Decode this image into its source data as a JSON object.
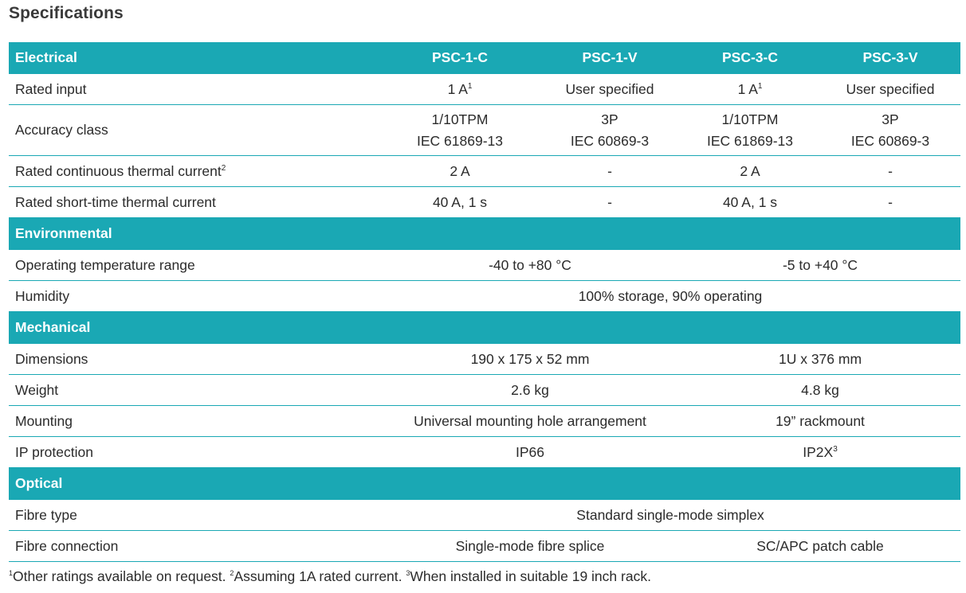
{
  "title": "Specifications",
  "columns": [
    "PSC-1-C",
    "PSC-1-V",
    "PSC-3-C",
    "PSC-3-V"
  ],
  "sections": {
    "electrical": {
      "heading": "Electrical",
      "rated_input": {
        "label": "Rated input",
        "c1": "1 A",
        "c1_sup": "1",
        "c2": "User specified",
        "c3": "1 A",
        "c3_sup": "1",
        "c4": "User specified"
      },
      "accuracy_class": {
        "label": "Accuracy class",
        "c1_l1": "1/10TPM",
        "c1_l2": "IEC 61869-13",
        "c2_l1": "3P",
        "c2_l2": "IEC 60869-3",
        "c3_l1": "1/10TPM",
        "c3_l2": "IEC 61869-13",
        "c4_l1": "3P",
        "c4_l2": "IEC 60869-3"
      },
      "continuous_current": {
        "label": "Rated continuous thermal current",
        "label_sup": "2",
        "c1": "2 A",
        "c2": "-",
        "c3": "2 A",
        "c4": "-"
      },
      "short_time_current": {
        "label": "Rated short-time thermal current",
        "c1": "40 A, 1 s",
        "c2": "-",
        "c3": "40 A, 1 s",
        "c4": "-"
      }
    },
    "environmental": {
      "heading": "Environmental",
      "temperature": {
        "label": "Operating temperature range",
        "psc1": "-40 to +80 °C",
        "psc3": "-5 to +40 °C"
      },
      "humidity": {
        "label": "Humidity",
        "all": "100% storage, 90% operating"
      }
    },
    "mechanical": {
      "heading": "Mechanical",
      "dimensions": {
        "label": "Dimensions",
        "psc1": "190 x 175 x 52 mm",
        "psc3": "1U x 376 mm"
      },
      "weight": {
        "label": "Weight",
        "psc1": "2.6 kg",
        "psc3": "4.8 kg"
      },
      "mounting": {
        "label": "Mounting",
        "psc1": "Universal mounting hole arrangement",
        "psc3": "19” rackmount"
      },
      "ip_protection": {
        "label": "IP protection",
        "psc1": "IP66",
        "psc3": "IP2X",
        "psc3_sup": "3"
      }
    },
    "optical": {
      "heading": "Optical",
      "fibre_type": {
        "label": "Fibre type",
        "all": "Standard single-mode simplex"
      },
      "fibre_connection": {
        "label": "Fibre connection",
        "psc1": "Single-mode fibre splice",
        "psc3": "SC/APC patch cable"
      }
    }
  },
  "footnotes": {
    "n1": "1",
    "t1": "Other ratings available on request.",
    "n2": "2",
    "t2": "Assuming 1A rated current.",
    "n3": "3",
    "t3": "When installed in suitable 19 inch rack."
  },
  "colors": {
    "accent": "#1aa8b4",
    "text": "#2b2b2b",
    "header_text": "#ffffff"
  }
}
